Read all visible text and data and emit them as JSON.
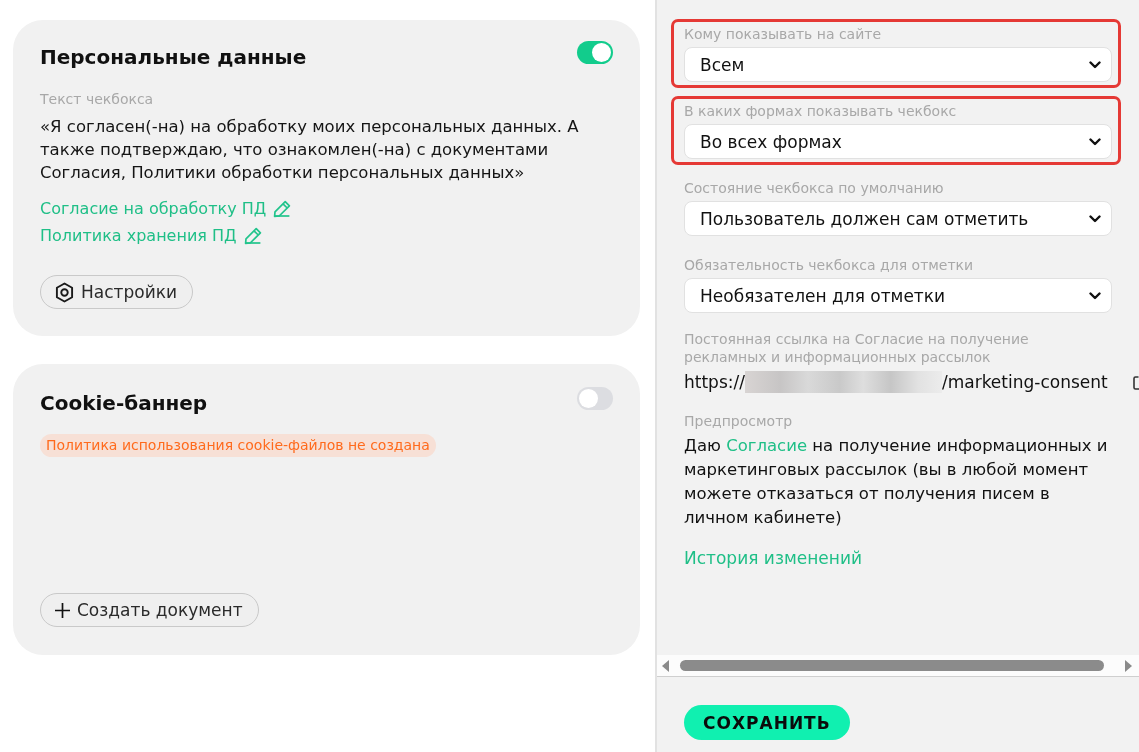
{
  "cards": [
    {
      "kind": "checkbox_text",
      "title": "Персональные данные",
      "on": true,
      "label": "Текст чекбокса",
      "text": "«Я согласен(-на) на обработку моих персональных данных. А также подтверждаю, что ознакомлен(-на) с документами Согласия, Политики обработки персональных данных»",
      "links": [
        "Согласие на обработку ПД",
        "Политика хранения ПД"
      ],
      "button": {
        "kind": "settings",
        "label": "Настройки"
      }
    },
    {
      "kind": "banner",
      "title": "Cookie-баннер",
      "on": false,
      "warning": "Политика использования cookie-файлов не создана",
      "button": {
        "kind": "create",
        "label": "Создать документ"
      }
    }
  ],
  "settings_panel": {
    "fields": [
      {
        "label": "Кому показывать на сайте",
        "value": "Всем",
        "highlighted": true
      },
      {
        "label": "В каких формах показывать чекбокс",
        "value": "Во всех формах",
        "highlighted": true
      },
      {
        "label": "Состояние чекбокса по умолчанию",
        "value": "Пользователь должен сам отметить",
        "highlighted": false
      },
      {
        "label": "Обязательность чекбокса для отметки",
        "value": "Необязателен для отметки",
        "highlighted": false
      }
    ],
    "permalink": {
      "label": "Постоянная ссылка на Согласие на получение рекламных и информационных рассылок",
      "prefix": "https://",
      "redacted": true,
      "suffix": "/marketing-consent"
    },
    "preview": {
      "label": "Предпросмотр",
      "before": "Даю",
      "link": "Согласие",
      "after": "на получение информационных и маркетинговых рассылок (вы в любой момент можете отказаться от получения писем в личном кабинете)"
    },
    "history_link": "История изменений",
    "save_button": "СОХРАНИТЬ"
  }
}
